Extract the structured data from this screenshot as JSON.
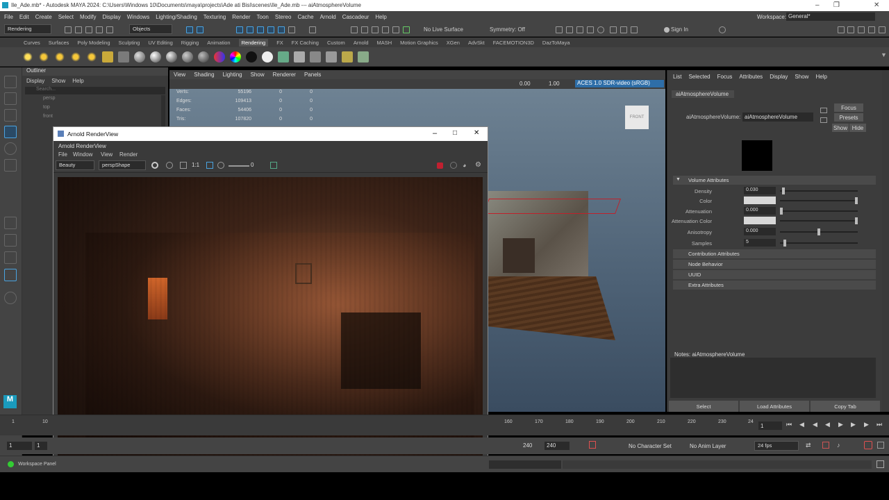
{
  "app": {
    "title": "Ile_Ade.mb* - Autodesk MAYA 2024: C:\\Users\\Windows 10\\Documents\\maya\\projects\\Ade ati Bisi\\scenes\\Ile_Ade.mb  ---  aiAtmosphereVolume"
  },
  "menubar": [
    "File",
    "Edit",
    "Create",
    "Select",
    "Modify",
    "Display",
    "Windows",
    "Lighting/Shading",
    "Texturing",
    "Render",
    "Toon",
    "Stereo",
    "Cache",
    "Arnold",
    "Cascadeur",
    "Help"
  ],
  "workspace": {
    "label": "Workspace:",
    "value": "General*"
  },
  "statusline": {
    "mode": "Rendering",
    "select_mode": "Objects",
    "live_surface": "No Live Surface",
    "symmetry": "Symmetry: Off",
    "sign_in": "Sign In"
  },
  "shelf_tabs": [
    "Curves",
    "Surfaces",
    "Poly Modeling",
    "Sculpting",
    "UV Editing",
    "Rigging",
    "Animation",
    "Rendering",
    "FX",
    "FX Caching",
    "Custom",
    "Arnold",
    "MASH",
    "Motion Graphics",
    "XGen",
    "AdvSkt",
    "FACEMOTION3D",
    "DazToMaya"
  ],
  "active_shelf_tab": "Rendering",
  "outliner": {
    "title": "Outliner",
    "menu": [
      "Display",
      "Show",
      "Help"
    ],
    "search_placeholder": "Search...",
    "items": [
      "persp",
      "top",
      "front"
    ]
  },
  "viewport": {
    "menu": [
      "View",
      "Shading",
      "Lighting",
      "Show",
      "Renderer",
      "Panels"
    ],
    "exposure": "0.00",
    "gamma": "1.00",
    "color_space": "ACES 1.0 SDR-video (sRGB)",
    "cube_label": "FRONT",
    "hud": [
      {
        "label": "Verts:",
        "a": "55196",
        "b": "0",
        "c": "0"
      },
      {
        "label": "Edges:",
        "a": "109413",
        "b": "0",
        "c": "0"
      },
      {
        "label": "Faces:",
        "a": "54406",
        "b": "0",
        "c": "0"
      },
      {
        "label": "Tris:",
        "a": "107820",
        "b": "0",
        "c": "0"
      }
    ]
  },
  "arnold": {
    "window_title": "Arnold RenderView",
    "menu_title": "Arnold RenderView",
    "menu": [
      "File",
      "Window",
      "View",
      "Render"
    ],
    "aov": "Beauty",
    "camera": "perspShape",
    "ratio": "1:1",
    "exposure": "0"
  },
  "attr_editor": {
    "menu": [
      "List",
      "Selected",
      "Focus",
      "Attributes",
      "Display",
      "Show",
      "Help"
    ],
    "tab": "aiAtmosphereVolume",
    "node_label": "aiAtmosphereVolume:",
    "node_value": "aiAtmosphereVolume",
    "focus": "Focus",
    "presets": "Presets",
    "show": "Show",
    "hide": "Hide",
    "sections": [
      "Volume Attributes",
      "Contribution Attributes",
      "Node Behavior",
      "UUID",
      "Extra Attributes"
    ],
    "attrs": [
      {
        "label": "Density",
        "value": "0.030",
        "slider": 0.03
      },
      {
        "label": "Color",
        "value": "",
        "slider": 1
      },
      {
        "label": "Attenuation",
        "value": "0.000",
        "slider": 0
      },
      {
        "label": "Attenuation Color",
        "value": "",
        "slider": 1
      },
      {
        "label": "Anisotropy",
        "value": "0.000",
        "slider": 0.5
      },
      {
        "label": "Samples",
        "value": "5",
        "slider": 0.05
      }
    ],
    "notes_label": "Notes: aiAtmosphereVolume",
    "buttons": [
      "Select",
      "Load Attributes",
      "Copy Tab"
    ]
  },
  "timeline": {
    "ticks_left": [
      "1",
      "10"
    ],
    "ticks": [
      "160",
      "170",
      "180",
      "190",
      "200",
      "210",
      "220",
      "230",
      "24"
    ],
    "current_frame": "1",
    "range_start": "1",
    "range_start2": "1",
    "range_end": "240",
    "range_end2": "240",
    "character_set": "No Character Set",
    "anim_layer": "No Anim Layer",
    "fps": "24 fps"
  },
  "cmdline": {
    "workspace_panel": "Workspace Panel"
  }
}
